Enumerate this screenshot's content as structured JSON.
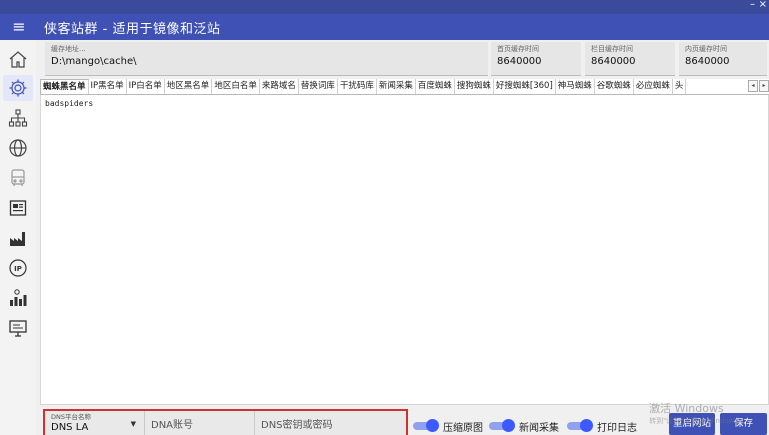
{
  "window": {
    "minimize": "–",
    "close": "×"
  },
  "titlebar": {
    "menu_icon": "hamburger-icon",
    "title": "侠客站群 - 适用于镜像和泛站"
  },
  "sidebar": {
    "items": [
      {
        "icon": "home-icon"
      },
      {
        "icon": "gear-icon",
        "active": true
      },
      {
        "icon": "sitemap-icon"
      },
      {
        "icon": "globe-icon"
      },
      {
        "icon": "bus-icon"
      },
      {
        "icon": "newspaper-icon"
      },
      {
        "icon": "factory-icon"
      },
      {
        "icon": "ip-icon",
        "text": "IP"
      },
      {
        "icon": "stats-icon"
      },
      {
        "icon": "monitor-icon"
      }
    ]
  },
  "cache": {
    "path": {
      "label": "缓存地址...",
      "value": "D:\\mango\\cache\\"
    },
    "home_time": {
      "label": "首页缓存时间",
      "value": "8640000"
    },
    "column_time": {
      "label": "栏目缓存时间",
      "value": "8640000"
    },
    "content_time": {
      "label": "内页缓存时间",
      "value": "8640000"
    }
  },
  "tabs": [
    "蜘蛛黑名单",
    "IP黑名单",
    "IP白名单",
    "地区黑名单",
    "地区白名单",
    "来路域名",
    "替换词库",
    "干扰码库",
    "新闻采集",
    "百度蜘蛛",
    "搜狗蜘蛛",
    "好搜蜘蛛[360]",
    "神马蜘蛛",
    "谷歌蜘蛛",
    "必应蜘蛛",
    "头"
  ],
  "tab_scroll": {
    "left": "◂",
    "right": "▸"
  },
  "editor": {
    "content": "badspiders"
  },
  "dns": {
    "platform_label": "DNS平台名称",
    "platform_value": "DNS LA",
    "account_placeholder": "DNA账号",
    "secret_placeholder": "DNS密钥或密码"
  },
  "toggles": [
    {
      "label": "压缩原图",
      "on": true
    },
    {
      "label": "新闻采集",
      "on": true
    },
    {
      "label": "打印日志",
      "on": true
    }
  ],
  "buttons": {
    "restart": "重启网站",
    "save": "保存"
  },
  "watermark": {
    "title": "激活 Windows",
    "subtitle": "转到\"设置\"以激活 Windows。"
  },
  "colors": {
    "primary": "#3f51b5",
    "accent": "#3d5afe",
    "highlight": "#d32f2f"
  }
}
